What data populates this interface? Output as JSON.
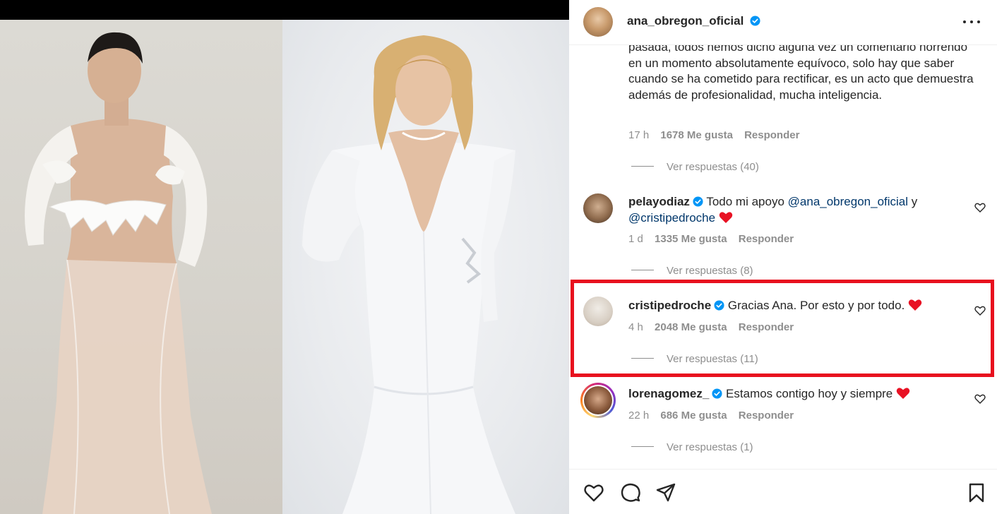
{
  "post": {
    "author": "ana_obregon_oficial",
    "verified": true
  },
  "caption_continued": {
    "text": "pasada, todos hemos dicho alguna vez un comentario horrendo en un momento absolutamente equívoco, solo hay que saber cuando se ha cometido para rectificar, es un acto que demuestra además de profesionalidad, mucha inteligencia.",
    "time": "17 h",
    "likes": "1678 Me gusta",
    "reply": "Responder",
    "view_replies": "Ver respuestas (40)"
  },
  "comments": [
    {
      "username": "pelayodiaz",
      "verified": true,
      "text_before": "Todo mi apoyo",
      "mention_1": "@ana_obregon_oficial",
      "text_between": "y",
      "mention_2": "@cristipedroche",
      "emoji": "red-heart",
      "time": "1 d",
      "likes": "1335 Me gusta",
      "reply": "Responder",
      "view_replies": "Ver respuestas (8)"
    },
    {
      "username": "cristipedroche",
      "verified": true,
      "text": "Gracias Ana. Por esto y por todo.",
      "emoji": "red-heart",
      "time": "4 h",
      "likes": "2048 Me gusta",
      "reply": "Responder",
      "view_replies": "Ver respuestas (11)",
      "highlighted": true,
      "highlight_color": "#e8101e"
    },
    {
      "username": "lorenagomez_",
      "verified": true,
      "text": "Estamos contigo hoy y siempre",
      "emoji": "red-heart",
      "time": "22 h",
      "likes": "686 Me gusta",
      "reply": "Responder",
      "view_replies": "Ver respuestas (1)",
      "story_ring": true
    }
  ],
  "actions": [
    "heart-icon",
    "comment-icon",
    "share-icon",
    "bookmark-icon"
  ],
  "colors": {
    "text": "#262626",
    "secondary": "#8e8e8e",
    "mention": "#00376b",
    "verified": "#0095f6",
    "highlight": "#e8101e"
  }
}
